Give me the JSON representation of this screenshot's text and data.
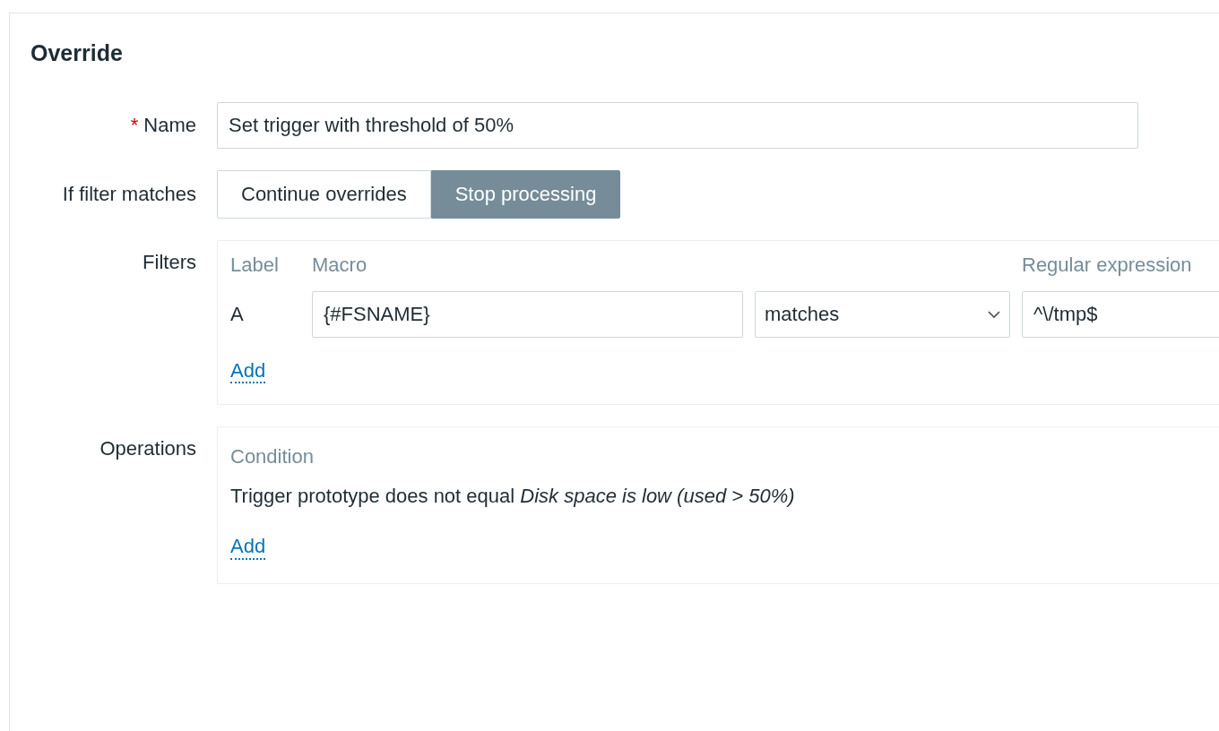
{
  "title": "Override",
  "name": {
    "required_mark": "*",
    "label": "Name",
    "value": "Set trigger with threshold of 50%"
  },
  "if_filter_matches": {
    "label": "If filter matches",
    "options": [
      {
        "label": "Continue overrides",
        "selected": false
      },
      {
        "label": "Stop processing",
        "selected": true
      }
    ]
  },
  "filters": {
    "label": "Filters",
    "columns": [
      "Label",
      "Macro",
      "Regular expression"
    ],
    "rows": [
      {
        "label": "A",
        "macro": "{#FSNAME}",
        "operator": "matches",
        "value": "^\\/tmp$"
      }
    ],
    "add": "Add"
  },
  "operations": {
    "label": "Operations",
    "columns": [
      "Condition"
    ],
    "rows": [
      "Trigger prototype does not equal *Disk space is low (used > 50%)*"
    ],
    "add": "Add"
  }
}
